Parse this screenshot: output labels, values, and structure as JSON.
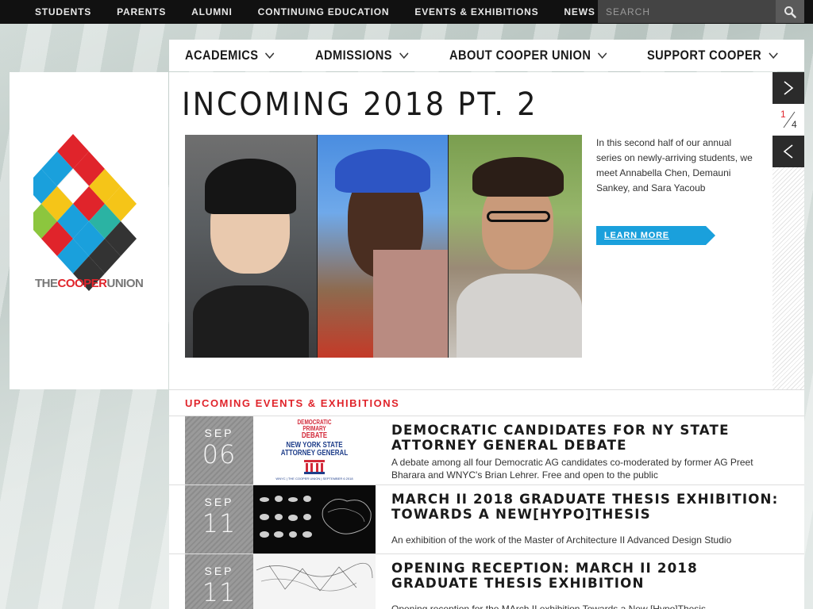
{
  "top_nav": {
    "links": [
      "STUDENTS",
      "PARENTS",
      "ALUMNI",
      "CONTINUING EDUCATION",
      "EVENTS & EXHIBITIONS",
      "NEWS"
    ],
    "search_placeholder": "SEARCH"
  },
  "main_nav": {
    "items": [
      "ACADEMICS",
      "ADMISSIONS",
      "ABOUT COOPER UNION",
      "SUPPORT COOPER"
    ]
  },
  "logo": {
    "text_prefix": "THE",
    "text_highlight": "COOPER",
    "text_suffix": "UNION"
  },
  "hero": {
    "title": "INCOMING 2018 PT. 2",
    "description": "In this second half of our annual series on newly-arriving students, we meet Annabella Chen, Demauni Sankey, and Sara Yacoub",
    "cta_label": "LEARN MORE",
    "slide_current": "1",
    "slide_total": "4"
  },
  "events": {
    "heading": "UPCOMING EVENTS & EXHIBITIONS",
    "items": [
      {
        "month": "SEP",
        "day": "06",
        "title": "DEMOCRATIC CANDIDATES FOR NY STATE ATTORNEY GENERAL DEBATE",
        "description": "A debate among all four Democratic AG candidates co-moderated by former AG Preet Bharara and WNYC's Brian Lehrer. Free and open to the public",
        "thumb_line1": "DEMOCRATIC",
        "thumb_line2": "PRIMARY",
        "thumb_line3": "DEBATE",
        "thumb_line4": "NEW YORK STATE",
        "thumb_line5": "ATTORNEY GENERAL",
        "thumb_footer": "WNYC | THE COOPER UNION | SEPTEMBER 6 2018"
      },
      {
        "month": "SEP",
        "day": "11",
        "title": "MARCH II 2018 GRADUATE THESIS EXHIBITION: TOWARDS A NEW[HYPO]THESIS",
        "description": "An exhibition of the work of the Master of Architecture II Advanced Design Studio"
      },
      {
        "month": "SEP",
        "day": "11",
        "title": "OPENING RECEPTION: MARCH II 2018 GRADUATE THESIS EXHIBITION",
        "description": "Opening reception for the MArch II exhibition Towards a New [Hypo]Thesis"
      }
    ]
  },
  "colors": {
    "accent_red": "#e0242b",
    "accent_blue": "#1aa0dc",
    "topbar": "#111111"
  }
}
